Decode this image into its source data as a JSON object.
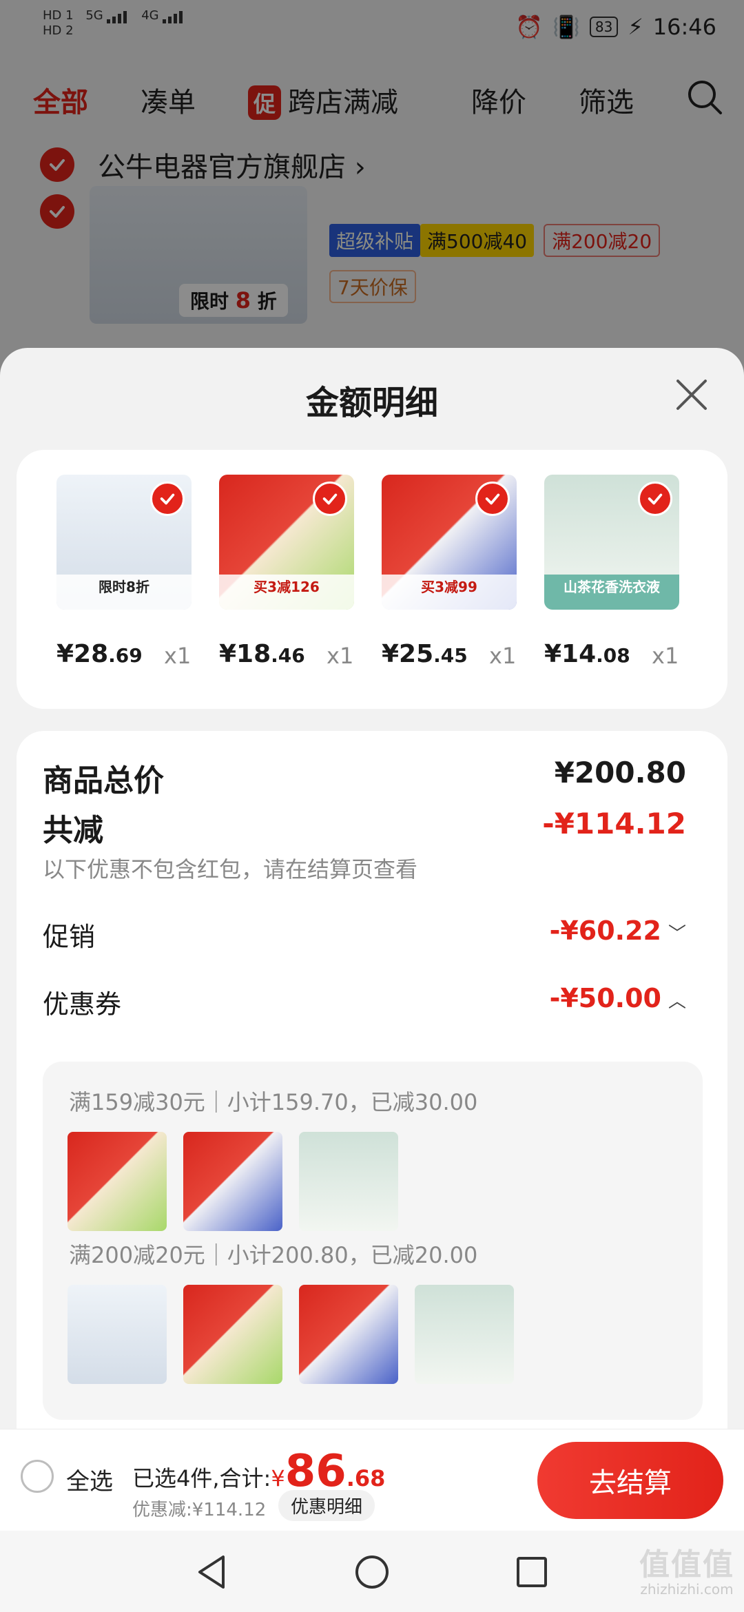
{
  "status_bar": {
    "sim1": "HD 1",
    "sim2": "HD 2",
    "net1": "5G",
    "net2": "4G",
    "battery": "83",
    "time": "16:46"
  },
  "top_tabs": {
    "all": "全部",
    "bundle": "凑单",
    "promo_badge": "促",
    "cross_store": "跨店满减",
    "price_drop": "降价",
    "filter": "筛选"
  },
  "store": {
    "name": "公牛电器官方旗舰店",
    "chevron": "›"
  },
  "bg_product": {
    "limit_prefix": "限时",
    "limit_num": "8",
    "limit_suffix": "折",
    "tag_subsidy": "超级补贴",
    "tag_500": "满500减40",
    "tag_200": "满200减20",
    "tag_protect": "7天价保"
  },
  "sheet": {
    "title": "金额明细"
  },
  "items": [
    {
      "price_int": "¥28",
      "price_dec": ".69",
      "qty": "x1",
      "label": "限时8折"
    },
    {
      "price_int": "¥18",
      "price_dec": ".46",
      "qty": "x1",
      "label": "买3减126"
    },
    {
      "price_int": "¥25",
      "price_dec": ".45",
      "qty": "x1",
      "label": "买3减99"
    },
    {
      "price_int": "¥14",
      "price_dec": ".08",
      "qty": "x1",
      "label": "山茶花香洗衣液"
    }
  ],
  "details": {
    "total_label": "商品总价",
    "total_value": "¥200.80",
    "reduce_label": "共减",
    "reduce_value": "-¥114.12",
    "hint": "以下优惠不包含红包，请在结算页查看",
    "promo_label": "促销",
    "promo_value": "-¥60.22",
    "coupon_label": "优惠券",
    "coupon_value": "-¥50.00",
    "coupon1": "满159减30元｜小计159.70，已减30.00",
    "coupon2": "满200减20元｜小计200.80，已减20.00"
  },
  "bottom_bar": {
    "select_all": "全选",
    "selected_prefix": "已选4件,合计:",
    "currency": "¥",
    "total_int": "86",
    "total_dec": ".68",
    "discount": "优惠减:¥114.12",
    "detail_btn": "优惠明细",
    "checkout": "去结算"
  },
  "watermark": {
    "logo": "值值值",
    "site": "zhizhizhi.com"
  },
  "colors": {
    "brand_red": "#e2231a",
    "gray_text": "#888888"
  }
}
